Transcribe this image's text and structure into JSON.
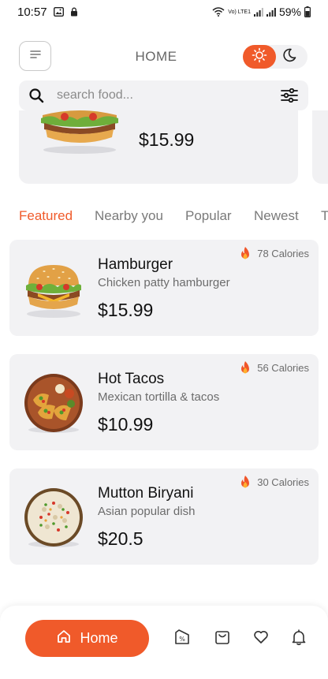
{
  "status": {
    "time": "10:57",
    "battery": "59%",
    "network_label": "Vo) LTE1"
  },
  "header": {
    "title": "HOME",
    "menu_icon": "menu-lines-icon",
    "theme_light_icon": "sun-icon",
    "theme_dark_icon": "moon-icon",
    "theme_active": "light"
  },
  "search": {
    "placeholder": "search food...",
    "value": ""
  },
  "promo": {
    "price": "$15.99"
  },
  "tabs": [
    {
      "label": "Featured",
      "active": true
    },
    {
      "label": "Nearby you",
      "active": false
    },
    {
      "label": "Popular",
      "active": false
    },
    {
      "label": "Newest",
      "active": false
    },
    {
      "label": "T",
      "active": false
    }
  ],
  "foods": [
    {
      "name": "Hamburger",
      "description": "Chicken patty hamburger",
      "price": "$15.99",
      "calories": "78 Calories",
      "image": "hamburger"
    },
    {
      "name": "Hot Tacos",
      "description": "Mexican tortilla & tacos",
      "price": "$10.99",
      "calories": "56 Calories",
      "image": "tacos"
    },
    {
      "name": "Mutton Biryani",
      "description": "Asian popular dish",
      "price": "$20.5",
      "calories": "30 Calories",
      "image": "biryani"
    }
  ],
  "bottom_nav": {
    "home_label": "Home",
    "items": [
      "home-icon",
      "discount-tag-icon",
      "shopping-bag-icon",
      "heart-icon",
      "bell-icon"
    ]
  },
  "colors": {
    "accent": "#f05a2a",
    "card_bg": "#f2f2f4",
    "muted_text": "#6c6c6c"
  }
}
